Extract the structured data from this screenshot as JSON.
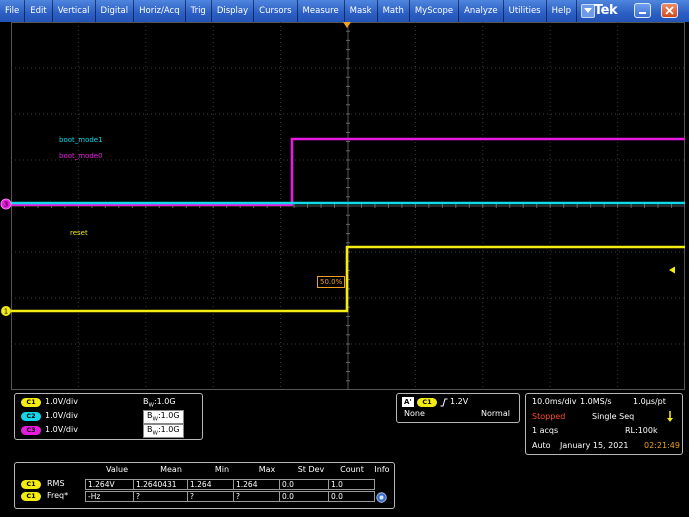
{
  "menu": {
    "items": [
      "File",
      "Edit",
      "Vertical",
      "Digital",
      "Horiz/Acq",
      "Trig",
      "Display",
      "Cursors",
      "Measure",
      "Mask",
      "Math",
      "MyScope",
      "Analyze",
      "Utilities",
      "Help"
    ]
  },
  "brand": "Tek",
  "colors": {
    "ch1": "#f3ec14",
    "ch2": "#13d8ea",
    "ch3": "#e81ce0",
    "trigger_marker": "#f0a020"
  },
  "waveforms": {
    "labels": {
      "ch2": "boot_mode1",
      "ch3": "boot_mode0",
      "ch1": "reset"
    },
    "trigger_label": "50.0%",
    "ch1_marker": "1",
    "ch3_marker": "3"
  },
  "channels": [
    {
      "badge": "C1",
      "scale": "1.0V/div",
      "bw_prefix": "B",
      "bw_sub": "W",
      "bw_value": ":1.0G",
      "color": "#f3ec14"
    },
    {
      "badge": "C2",
      "scale": "1.0V/div",
      "bw_prefix": "B",
      "bw_sub": "W",
      "bw_value": ":1.0G",
      "color": "#13d8ea"
    },
    {
      "badge": "C3",
      "scale": "1.0V/div",
      "bw_prefix": "B",
      "bw_sub": "W",
      "bw_value": ":1.0G",
      "color": "#e81ce0"
    }
  ],
  "trigger": {
    "badge_a": "A'",
    "badge_ch": "C1",
    "edge_icon": "rising-edge-icon",
    "level": "1.2V",
    "coupling": "None",
    "mode": "Normal"
  },
  "acquisition": {
    "timebase": "10.0ms/div",
    "sample_rate": "1.0MS/s",
    "resolution": "1.0µs/pt",
    "status": "Stopped",
    "sequence": "Single Seq",
    "acqs": "1 acqs",
    "record_length": "RL:100k",
    "mode": "Auto",
    "date": "January 15, 2021",
    "time": "02:21:49"
  },
  "measurements": {
    "headers": [
      "Value",
      "Mean",
      "Min",
      "Max",
      "St Dev",
      "Count",
      "Info"
    ],
    "rows": [
      {
        "badge": "C1",
        "name": "RMS",
        "cells": [
          "1.264V",
          "1.2640431",
          "1.264",
          "1.264",
          "0.0",
          "1.0"
        ]
      },
      {
        "badge": "C1",
        "name": "Freq*",
        "cells": [
          "-Hz",
          "?",
          "?",
          "?",
          "0.0",
          "0.0"
        ]
      }
    ]
  }
}
